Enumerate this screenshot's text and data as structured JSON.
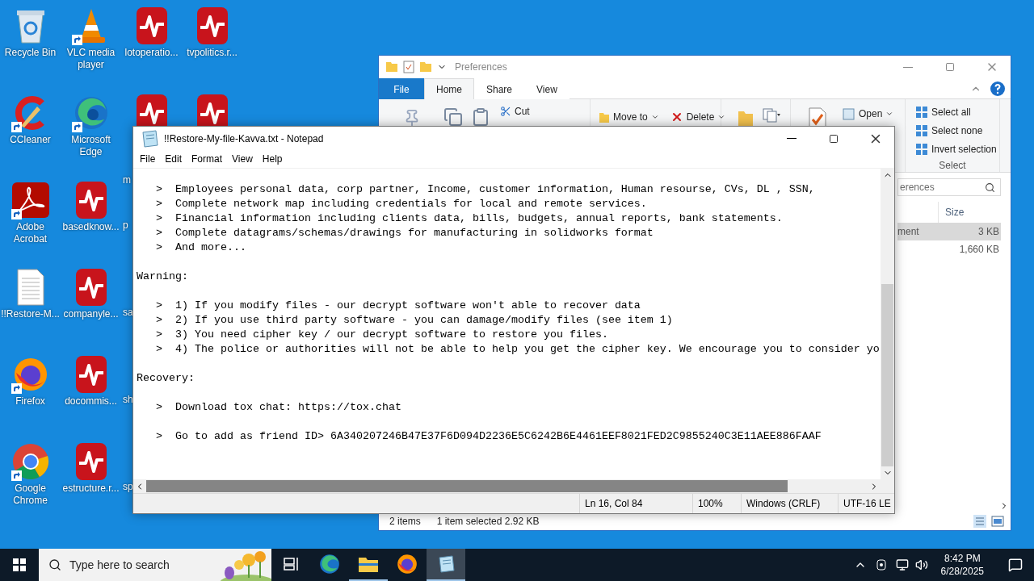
{
  "desktop_icons": [
    {
      "label": "Recycle Bin",
      "kind": "recycle",
      "shortcut": false
    },
    {
      "label": "CCleaner",
      "kind": "ccleaner",
      "shortcut": true
    },
    {
      "label": "Adobe Acrobat",
      "kind": "acrobat",
      "shortcut": true
    },
    {
      "label": "!!Restore-M...",
      "kind": "textfile",
      "shortcut": false
    },
    {
      "label": "Firefox",
      "kind": "firefox",
      "shortcut": true
    },
    {
      "label": "Google Chrome",
      "kind": "chrome",
      "shortcut": true
    },
    {
      "label": "VLC media player",
      "kind": "vlc",
      "shortcut": true
    },
    {
      "label": "Microsoft Edge",
      "kind": "edge",
      "shortcut": true
    },
    {
      "label": "basedknow...",
      "kind": "pulse",
      "shortcut": false
    },
    {
      "label": "companyle...",
      "kind": "pulse",
      "shortcut": false
    },
    {
      "label": "docommis...",
      "kind": "pulse",
      "shortcut": false
    },
    {
      "label": "estructure.r...",
      "kind": "pulse",
      "shortcut": false
    },
    {
      "label": "lotoperatio...",
      "kind": "pulse",
      "shortcut": false
    },
    {
      "label": "m",
      "kind": "pulse",
      "clipped": true
    },
    {
      "label": "p",
      "kind": "covered",
      "clipped": true
    },
    {
      "label": "sa",
      "kind": "covered",
      "clipped": true
    },
    {
      "label": "sh",
      "kind": "covered",
      "clipped": true
    },
    {
      "label": "sp",
      "kind": "covered",
      "clipped": true
    },
    {
      "label": "tvpolitics.r...",
      "kind": "pulse",
      "shortcut": false
    },
    {
      "kind": "pulse"
    }
  ],
  "explorer": {
    "title": "Preferences",
    "tabs": [
      {
        "label": "File",
        "kind": "file",
        "selected": false
      },
      {
        "label": "Home",
        "kind": "tab",
        "selected": true
      },
      {
        "label": "Share",
        "kind": "tab",
        "selected": false
      },
      {
        "label": "View",
        "kind": "tab",
        "selected": false
      }
    ],
    "ribbon": {
      "cut": "Cut",
      "move_to": "Move to",
      "delete": "Delete",
      "open": "Open",
      "select_items": [
        "Select all",
        "Select none",
        "Invert selection"
      ],
      "select_group": "Select"
    },
    "search": {
      "placeholder": "erences"
    },
    "columns": [
      "Size"
    ],
    "rows": [
      {
        "type": "ment",
        "size": "3 KB",
        "selected": true
      },
      {
        "size": "1,660 KB",
        "selected": false
      }
    ],
    "status": {
      "items": "2 items",
      "selection": "1 item selected  2.92 KB"
    }
  },
  "notepad": {
    "title": "!!Restore-My-file-Kavva.txt - Notepad",
    "menu": [
      "File",
      "Edit",
      "Format",
      "View",
      "Help"
    ],
    "lines": [
      {
        "kind": "bullet",
        "marker": ">",
        "text": "Employees personal data, corp partner, Income, customer information, Human resourse, CVs, DL , SSN,"
      },
      {
        "kind": "bullet",
        "marker": ">",
        "text": "Complete network map including credentials for local and remote services."
      },
      {
        "kind": "bullet",
        "marker": ">",
        "text": "Financial information including clients data, bills, budgets, annual reports, bank statements."
      },
      {
        "kind": "bullet",
        "marker": ">",
        "text": "Complete datagrams/schemas/drawings for manufacturing in solidworks format"
      },
      {
        "kind": "bullet",
        "marker": ">",
        "text": "And more..."
      },
      {
        "kind": "blank"
      },
      {
        "kind": "heading",
        "text": "Warning:"
      },
      {
        "kind": "blank"
      },
      {
        "kind": "bullet",
        "marker": ">",
        "text": "1) If you modify files - our decrypt software won't able to recover data"
      },
      {
        "kind": "bullet",
        "marker": ">",
        "text": "2) If you use third party software - you can damage/modify files (see item 1)"
      },
      {
        "kind": "bullet",
        "marker": ">",
        "text": "3) You need cipher key / our decrypt software to restore you files."
      },
      {
        "kind": "bullet",
        "marker": ">",
        "text": "4) The police or authorities will not be able to help you get the cipher key. We encourage you to consider yo"
      },
      {
        "kind": "blank"
      },
      {
        "kind": "heading",
        "text": "Recovery:"
      },
      {
        "kind": "blank"
      },
      {
        "kind": "bullet",
        "marker": ">",
        "text": "Download tox chat: https://tox.chat"
      },
      {
        "kind": "blank"
      },
      {
        "kind": "bullet",
        "marker": ">",
        "text": "Go to add as friend ID> 6A340207246B47E37F6D094D2236E5C6242B6E4461EEF8021FED2C9855240C3E11AEE886FAAF"
      }
    ],
    "status": [
      "Ln 16, Col 84",
      "100%",
      "Windows (CRLF)",
      "UTF-16 LE"
    ]
  },
  "taskbar": {
    "search": {
      "placeholder": "Type here to search"
    },
    "apps": [
      {
        "kind": "task-view",
        "running": false,
        "selected": false
      },
      {
        "kind": "edge",
        "running": false,
        "selected": false
      },
      {
        "kind": "explorer",
        "running": true,
        "selected": false
      },
      {
        "kind": "firefox",
        "running": false,
        "selected": false
      },
      {
        "kind": "notepad",
        "running": true,
        "selected": true
      }
    ],
    "time": "8:42 PM",
    "date": "6/28/2025"
  }
}
